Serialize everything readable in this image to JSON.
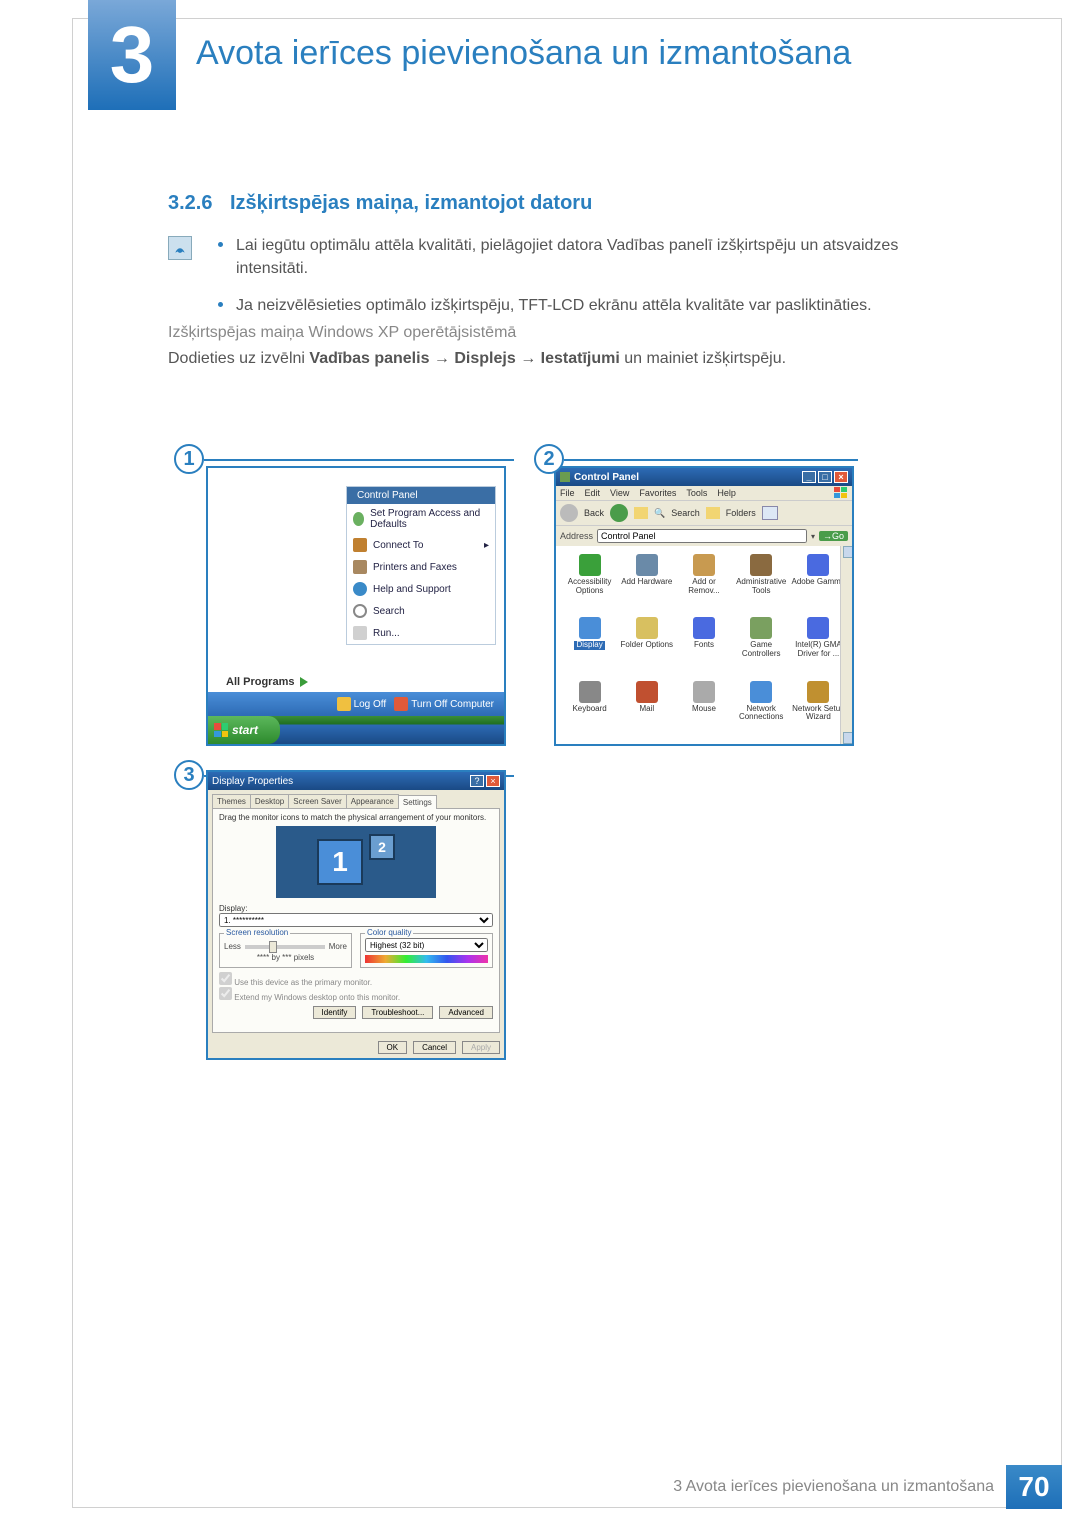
{
  "chapter": {
    "number": "3",
    "title": "Avota ierīces pievienošana un izmantošana"
  },
  "section": {
    "number": "3.2.6",
    "title": "Izšķirtspējas maiņa, izmantojot datoru"
  },
  "bullets": [
    "Lai iegūtu optimālu attēla kvalitāti, pielāgojiet datora Vadības panelī izšķirtspēju un atsvaidzes intensitāti.",
    "Ja neizvēlēsieties optimālo izšķirtspēju, TFT-LCD ekrānu attēla kvalitāte var pasliktināties."
  ],
  "subheading": "Izšķirtspējas maiņa Windows XP operētājsistēmā",
  "instruction": {
    "pre": "Dodieties uz izvēlni ",
    "path": [
      "Vadības panelis",
      "Displejs",
      "Iestatījumi"
    ],
    "post": " un mainiet izšķirtspēju."
  },
  "callouts": {
    "c1": "1",
    "c2": "2",
    "c3": "3"
  },
  "fig1": {
    "start_menu": {
      "header": "Control Panel",
      "items": [
        "Set Program Access and Defaults",
        "Connect To",
        "Printers and Faxes",
        "Help and Support",
        "Search",
        "Run..."
      ]
    },
    "all_programs": "All Programs",
    "log_off": "Log Off",
    "turn_off": "Turn Off Computer",
    "start": "start"
  },
  "fig2": {
    "title": "Control Panel",
    "menu": [
      "File",
      "Edit",
      "View",
      "Favorites",
      "Tools",
      "Help"
    ],
    "toolbar": {
      "back": "Back",
      "search": "Search",
      "folders": "Folders"
    },
    "address_label": "Address",
    "address_value": "Control Panel",
    "go": "Go",
    "items": [
      {
        "label": "Accessibility Options",
        "color": "#3aa03a"
      },
      {
        "label": "Add Hardware",
        "color": "#6a8aa8"
      },
      {
        "label": "Add or Remov...",
        "color": "#c89a50"
      },
      {
        "label": "Administrative Tools",
        "color": "#8a6a40"
      },
      {
        "label": "Adobe Gamma",
        "color": "#4a6ae0"
      },
      {
        "label": "Display",
        "color": "#4a8ed8",
        "selected": true
      },
      {
        "label": "Folder Options",
        "color": "#d8c060"
      },
      {
        "label": "Fonts",
        "color": "#4a6ae0"
      },
      {
        "label": "Game Controllers",
        "color": "#7aa060"
      },
      {
        "label": "Intel(R) GMA Driver for ...",
        "color": "#4a6ae0"
      },
      {
        "label": "Keyboard",
        "color": "#888"
      },
      {
        "label": "Mail",
        "color": "#c05030"
      },
      {
        "label": "Mouse",
        "color": "#aaa"
      },
      {
        "label": "Network Connections",
        "color": "#4a8ed8"
      },
      {
        "label": "Network Setup Wizard",
        "color": "#c09030"
      }
    ]
  },
  "fig3": {
    "title": "Display Properties",
    "tabs": [
      "Themes",
      "Desktop",
      "Screen Saver",
      "Appearance",
      "Settings"
    ],
    "active_tab": 4,
    "hint": "Drag the monitor icons to match the physical arrangement of your monitors.",
    "mon1": "1",
    "mon2": "2",
    "display_label": "Display:",
    "display_value": "1. **********",
    "screen_res_legend": "Screen resolution",
    "less": "Less",
    "more": "More",
    "res_text": "**** by *** pixels",
    "color_legend": "Color quality",
    "color_value": "Highest (32 bit)",
    "chk1": "Use this device as the primary monitor.",
    "chk2": "Extend my Windows desktop onto this monitor.",
    "identify": "Identify",
    "troubleshoot": "Troubleshoot...",
    "advanced": "Advanced",
    "ok": "OK",
    "cancel": "Cancel",
    "apply": "Apply"
  },
  "footer": {
    "text": "3 Avota ierīces pievienošana un izmantošana",
    "page": "70"
  }
}
